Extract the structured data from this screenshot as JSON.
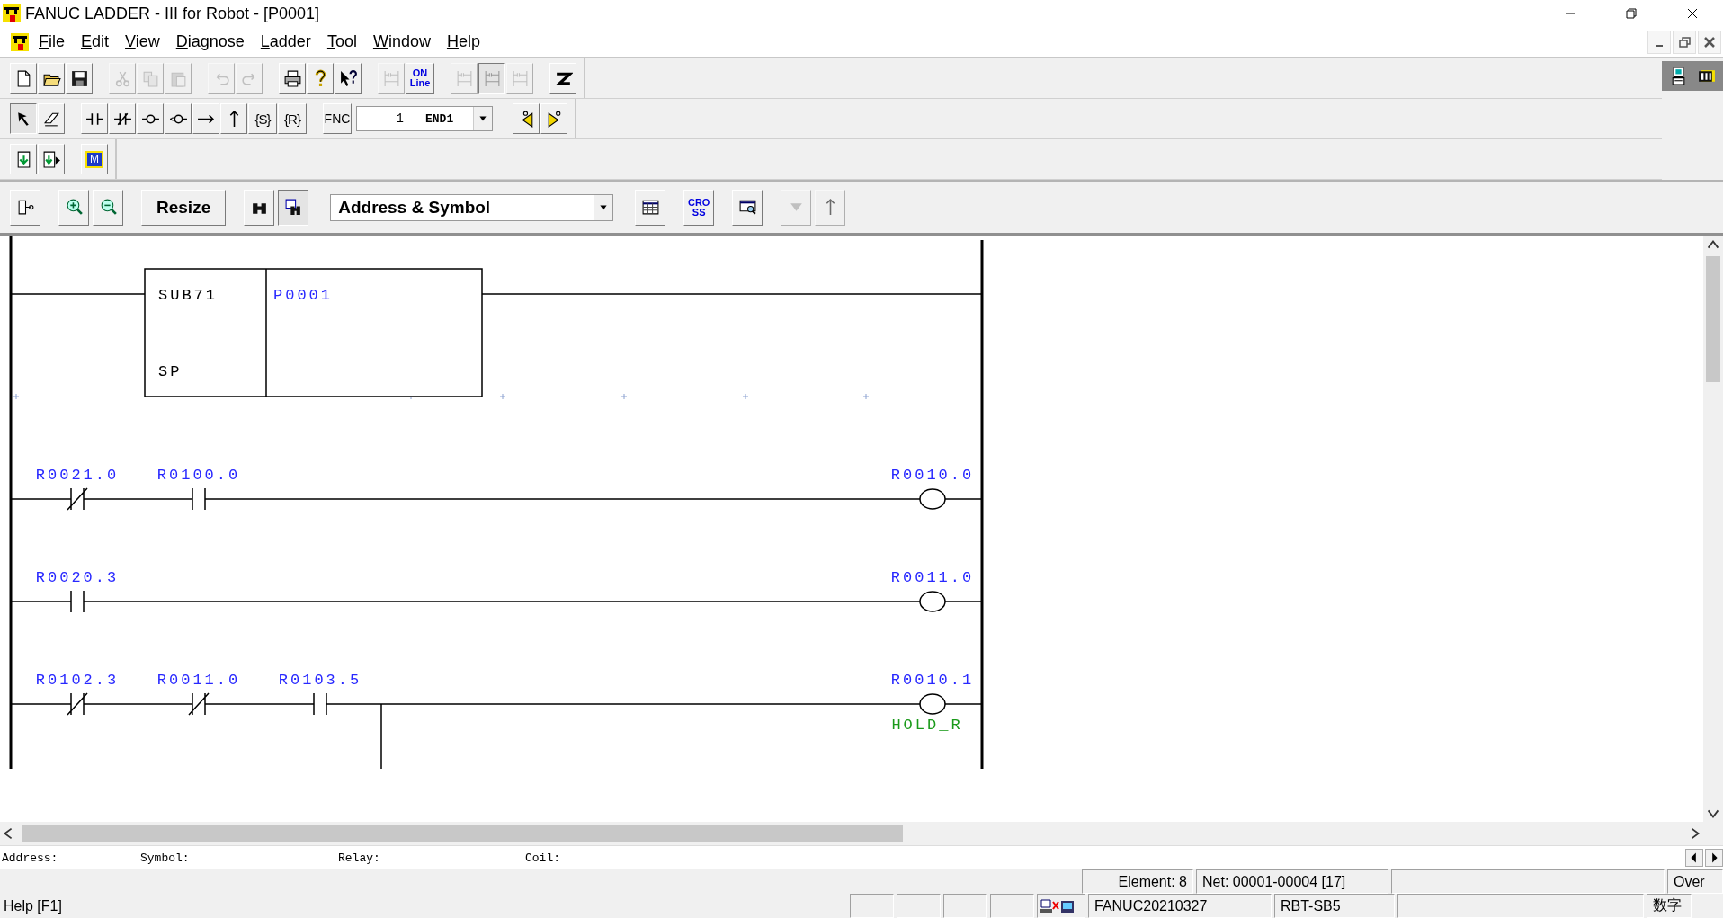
{
  "window": {
    "title": "FANUC LADDER - III for Robot - [P0001]"
  },
  "menu": [
    {
      "label": "File"
    },
    {
      "label": "Edit"
    },
    {
      "label": "View"
    },
    {
      "label": "Diagnose"
    },
    {
      "label": "Ladder"
    },
    {
      "label": "Tool"
    },
    {
      "label": "Window"
    },
    {
      "label": "Help"
    }
  ],
  "toolbars": [
    {
      "items": [
        {
          "kind": "icon",
          "disabled": false,
          "pressed": false
        },
        {
          "kind": "icon",
          "disabled": false,
          "pressed": false
        },
        {
          "kind": "icon",
          "disabled": false,
          "pressed": false
        },
        {
          "kind": "icon",
          "disabled": true,
          "pressed": false
        },
        {
          "kind": "icon",
          "disabled": true,
          "pressed": false
        },
        {
          "kind": "icon",
          "disabled": true,
          "pressed": false
        },
        {
          "kind": "icon",
          "disabled": true,
          "pressed": false
        },
        {
          "kind": "icon",
          "disabled": true,
          "pressed": false
        },
        {
          "kind": "icon",
          "disabled": false,
          "pressed": false
        },
        {
          "kind": "icon",
          "disabled": false,
          "pressed": false
        },
        {
          "kind": "icon",
          "disabled": false,
          "pressed": false
        },
        {
          "kind": "icon",
          "disabled": true,
          "pressed": false
        },
        {
          "kind": "label",
          "lines": [
            "ON",
            "Line"
          ],
          "disabled": false,
          "pressed": false
        },
        {
          "kind": "icon",
          "disabled": true,
          "pressed": false
        },
        {
          "kind": "icon",
          "disabled": false,
          "pressed": true
        },
        {
          "kind": "icon",
          "disabled": true,
          "pressed": false
        },
        {
          "kind": "icon",
          "disabled": false,
          "pressed": false
        }
      ]
    },
    {
      "items": [
        {
          "kind": "icon",
          "disabled": false,
          "pressed": true
        },
        {
          "kind": "icon",
          "disabled": false,
          "pressed": false
        },
        {
          "kind": "icon",
          "disabled": false,
          "pressed": false
        },
        {
          "kind": "icon",
          "disabled": false,
          "pressed": false
        },
        {
          "kind": "icon",
          "disabled": false,
          "pressed": false
        },
        {
          "kind": "icon",
          "disabled": false,
          "pressed": false
        },
        {
          "kind": "icon",
          "disabled": false,
          "pressed": false
        },
        {
          "kind": "icon",
          "disabled": false,
          "pressed": false
        },
        {
          "kind": "coil_label",
          "label": "{S}",
          "disabled": false,
          "pressed": false
        },
        {
          "kind": "coil_label",
          "label": "{R}",
          "disabled": false,
          "pressed": false
        },
        {
          "kind": "label",
          "lines": [
            "FNC"
          ],
          "disabled": false,
          "pressed": false
        },
        {
          "kind": "combo",
          "number": "1",
          "value": "END1"
        },
        {
          "kind": "icon",
          "disabled": false,
          "pressed": false
        },
        {
          "kind": "icon",
          "disabled": false,
          "pressed": false
        }
      ]
    },
    {
      "items": [
        {
          "kind": "icon",
          "disabled": false,
          "pressed": false
        },
        {
          "kind": "icon",
          "disabled": false,
          "pressed": false
        },
        {
          "kind": "boxed_letter",
          "label": "M",
          "disabled": false,
          "pressed": false
        }
      ]
    },
    {
      "items": [
        {
          "kind": "icon",
          "disabled": false,
          "pressed": false
        },
        {
          "kind": "icon",
          "disabled": false,
          "pressed": false
        },
        {
          "kind": "icon",
          "disabled": false,
          "pressed": false
        },
        {
          "kind": "text",
          "label": "Resize",
          "disabled": false,
          "pressed": false
        },
        {
          "kind": "icon",
          "disabled": false,
          "pressed": false
        },
        {
          "kind": "icon",
          "disabled": false,
          "pressed": true
        },
        {
          "kind": "select",
          "value": "Address & Symbol"
        },
        {
          "kind": "icon",
          "disabled": false,
          "pressed": false
        },
        {
          "kind": "label",
          "lines": [
            "CRO",
            "SS"
          ],
          "disabled": false,
          "pressed": false
        },
        {
          "kind": "icon",
          "disabled": false,
          "pressed": false
        },
        {
          "kind": "icon",
          "disabled": true,
          "pressed": false
        },
        {
          "kind": "icon",
          "disabled": true,
          "pressed": false
        }
      ]
    }
  ],
  "ladder": {
    "rungs": [
      {
        "kind": "function",
        "name": "SUB71",
        "parameter": "SP",
        "operand": "P0001"
      },
      {
        "kind": "logic",
        "contacts": [
          {
            "address": "R0021.0",
            "kind": "nc"
          },
          {
            "address": "R0100.0",
            "kind": "no"
          }
        ],
        "coil": {
          "address": "R0010.0"
        }
      },
      {
        "kind": "logic",
        "contacts": [
          {
            "address": "R0020.3",
            "kind": "no"
          }
        ],
        "coil": {
          "address": "R0011.0"
        }
      },
      {
        "kind": "logic",
        "contacts": [
          {
            "address": "R0102.3",
            "kind": "nc"
          },
          {
            "address": "R0011.0",
            "kind": "nc"
          },
          {
            "address": "R0103.5",
            "kind": "no"
          }
        ],
        "coil": {
          "address": "R0010.1",
          "symbol": "HOLD_R"
        },
        "branch": {
          "kind": "open_down"
        }
      }
    ]
  },
  "info_line": [
    {
      "label": "Address:"
    },
    {
      "label": "Symbol:"
    },
    {
      "label": "Relay:"
    },
    {
      "label": "Coil:"
    }
  ],
  "status_bar": {
    "element": "Element: 8",
    "net": "Net: 00001-00004 [17]",
    "mode": "Over",
    "help": "Help [F1]",
    "project": "FANUC20210327",
    "robot": "RBT-SB5",
    "input_mode": "数字"
  }
}
